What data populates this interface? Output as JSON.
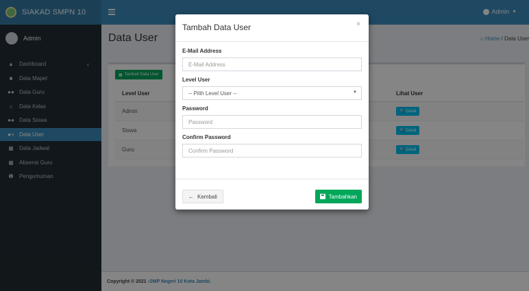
{
  "app": {
    "title": "SIAKAD SMPN 10"
  },
  "user_panel": {
    "name": "Admin"
  },
  "sidebar": {
    "items": [
      {
        "label": "Dashboard",
        "icon": "dashboard-icon"
      },
      {
        "label": "Data Mapel",
        "icon": "book-icon"
      },
      {
        "label": "Data Guru",
        "icon": "users-icon"
      },
      {
        "label": "Data Kelas",
        "icon": "home-icon"
      },
      {
        "label": "Data Siswa",
        "icon": "users-icon"
      },
      {
        "label": "Data User",
        "icon": "user-plus-icon"
      },
      {
        "label": "Data Jadwal",
        "icon": "calendar-icon"
      },
      {
        "label": "Absensi Guru",
        "icon": "calendar-check-icon"
      },
      {
        "label": "Pengumuman",
        "icon": "info-icon"
      }
    ],
    "active": "Data User"
  },
  "header": {
    "user_label": "Admin"
  },
  "page": {
    "title": "Data User",
    "breadcrumb": {
      "home": "Home",
      "current": "Data User"
    }
  },
  "box": {
    "add_button": "Tambah Data User",
    "columns": {
      "level": "Level User",
      "lihat": "Lihat User"
    },
    "rows": [
      {
        "level": "Admin",
        "action": "Detail"
      },
      {
        "level": "Siswa",
        "action": "Detail"
      },
      {
        "level": "Guru",
        "action": "Detail"
      }
    ]
  },
  "footer": {
    "prefix": "Copyright © 2021 - ",
    "link": "SMP Negeri 10 Kota Jambi."
  },
  "modal": {
    "title": "Tambah Data User",
    "close": "×",
    "fields": {
      "email": {
        "label": "E-Mail Address",
        "placeholder": "E-Mail Address"
      },
      "level": {
        "label": "Level User",
        "value": "-- Pilih Level User --"
      },
      "password": {
        "label": "Password",
        "placeholder": "Password"
      },
      "confirm": {
        "label": "Confirm Password",
        "placeholder": "Confirm Password"
      }
    },
    "back_button": "Kembali",
    "submit_button": "Tambahkan"
  },
  "colors": {
    "primary": "#3c8dbc",
    "sidebar": "#222d32",
    "success": "#00a65a",
    "info": "#00c0ef"
  }
}
